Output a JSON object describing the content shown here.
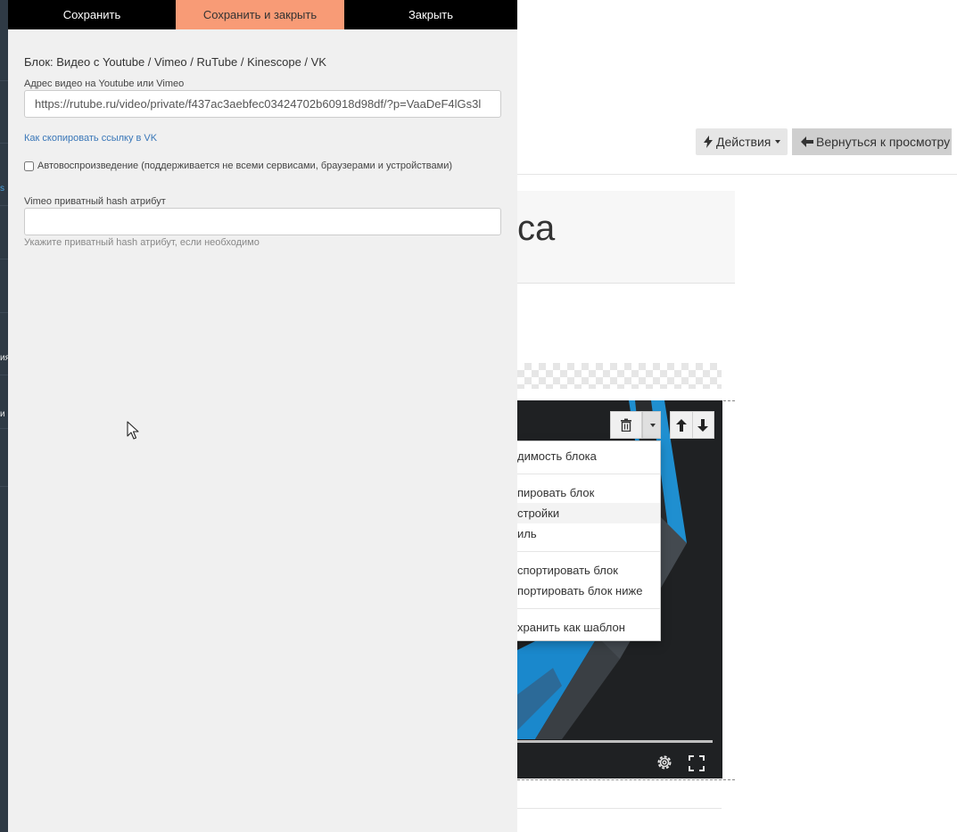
{
  "toolbar": {
    "save_label": "Сохранить",
    "save_close_label": "Сохранить и закрыть",
    "close_label": "Закрыть"
  },
  "editor": {
    "block_title": "Блок: Видео с Youtube / Vimeo / RuTube / Kinescope / VK",
    "url_label": "Адрес видео на Youtube или Vimeo",
    "url_value": "https://rutube.ru/video/private/f437ac3aebfec03424702b60918d98df/?p=VaaDeF4lGs3l",
    "vk_link": "Как скопировать ссылку в VK",
    "autoplay_label": "Автовоспроизведение (поддерживается не всеми сервисами, браузерами и устройствами)",
    "autoplay_checked": false,
    "hash_label": "Vimeo приватный hash атрибут",
    "hash_value": "",
    "hash_help": "Укажите приватный hash атрибут, если необходимо"
  },
  "background": {
    "actions_label": "Действия",
    "back_label": "Вернуться к просмотру",
    "title_fragment": "са",
    "sidebar_fragments": [
      "ия",
      "и"
    ],
    "dropdown_items": [
      "димость блока",
      "пировать блок",
      "стройки",
      "иль",
      "спортировать блок",
      "портировать блок ниже",
      "хранить как шаблон"
    ]
  },
  "colors": {
    "accent": "#f89b76",
    "toolbar_bg": "#000000",
    "panel_bg": "#f0f0f0",
    "link": "#3a77b8"
  },
  "icons": [
    "bolt-icon",
    "caret-down-icon",
    "arrow-left-icon",
    "trash-icon",
    "arrow-up-icon",
    "arrow-down-icon",
    "settings-gear-icon",
    "fullscreen-icon",
    "mouse-cursor-icon"
  ]
}
